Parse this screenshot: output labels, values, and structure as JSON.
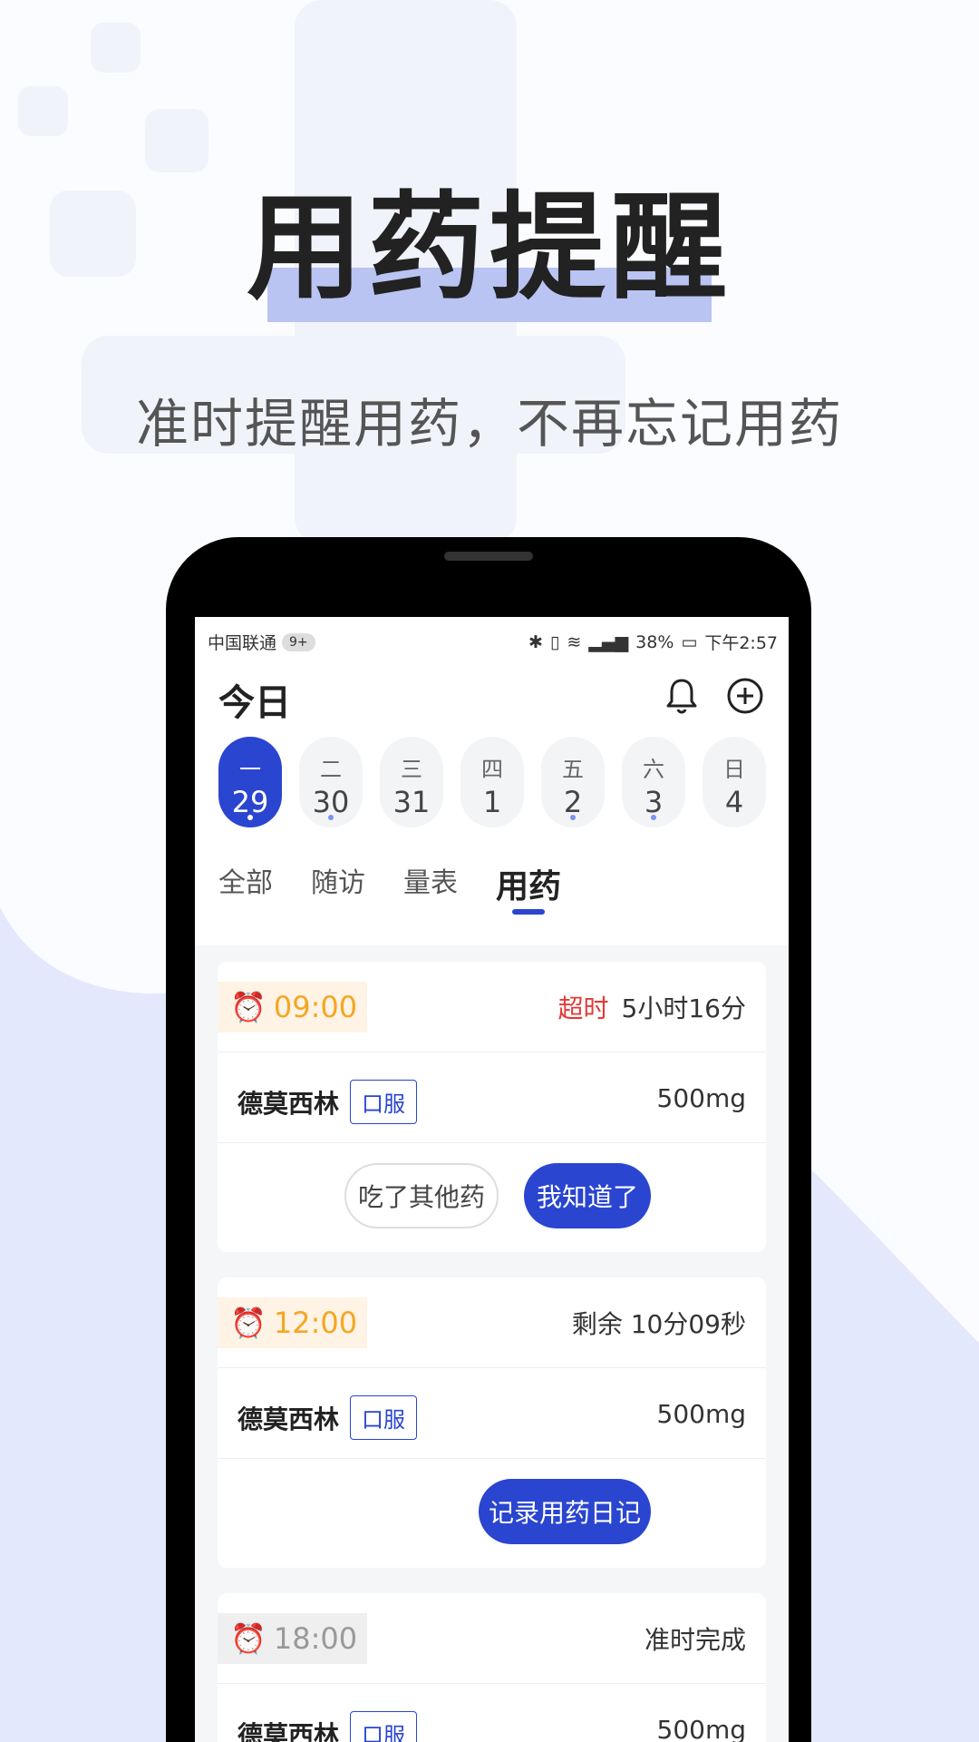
{
  "hero": {
    "title": "用药提醒",
    "subtitle": "准时提醒用药，不再忘记用药"
  },
  "statusbar": {
    "carrier": "中国联通",
    "badge": "9+",
    "battery": "38%",
    "time": "下午2:57"
  },
  "header": {
    "title": "今日"
  },
  "days": [
    {
      "weekday": "一",
      "date": "29",
      "active": true,
      "dot": true
    },
    {
      "weekday": "二",
      "date": "30",
      "active": false,
      "dot": true
    },
    {
      "weekday": "三",
      "date": "31",
      "active": false,
      "dot": false
    },
    {
      "weekday": "四",
      "date": "1",
      "active": false,
      "dot": false
    },
    {
      "weekday": "五",
      "date": "2",
      "active": false,
      "dot": true
    },
    {
      "weekday": "六",
      "date": "3",
      "active": false,
      "dot": true
    },
    {
      "weekday": "日",
      "date": "4",
      "active": false,
      "dot": false
    }
  ],
  "tabs": [
    "全部",
    "随访",
    "量表",
    "用药"
  ],
  "cards": [
    {
      "time": "09:00",
      "status_warn": "超时",
      "status": "5小时16分",
      "drug": "德莫西林",
      "tag": "口服",
      "dose": "500mg",
      "btn_secondary": "吃了其他药",
      "btn_primary": "我知道了"
    },
    {
      "time": "12:00",
      "status": "剩余  10分09秒",
      "drug": "德莫西林",
      "tag": "口服",
      "dose": "500mg",
      "btn_primary": "记录用药日记"
    },
    {
      "time": "18:00",
      "status": "准时完成",
      "drug": "德莫西林",
      "tag": "口服",
      "dose": "500mg"
    }
  ],
  "colors": {
    "accent": "#2a45d0",
    "warn": "#e53935",
    "orange": "#f5a623"
  }
}
